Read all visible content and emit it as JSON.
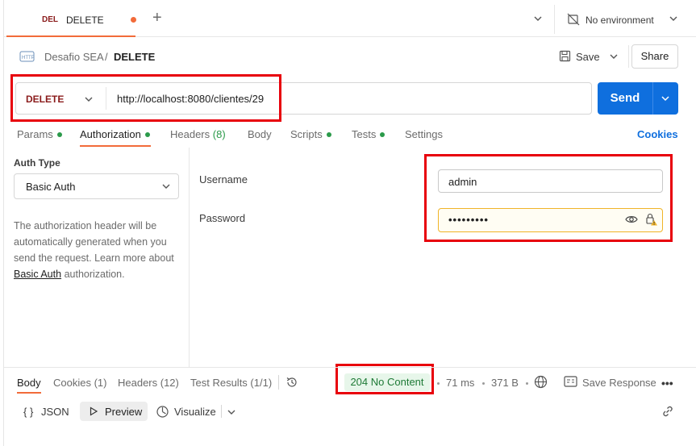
{
  "tab": {
    "method": "DEL",
    "title": "DELETE"
  },
  "environment": {
    "label": "No environment"
  },
  "breadcrumb": {
    "parent": "Desafio SEA",
    "separator": "/",
    "current": "DELETE"
  },
  "header_actions": {
    "save_label": "Save",
    "share_label": "Share"
  },
  "request": {
    "method": "DELETE",
    "url": "http://localhost:8080/clientes/29",
    "send_label": "Send"
  },
  "request_tabs": {
    "params": "Params",
    "authorization": "Authorization",
    "headers": "Headers",
    "headers_count": "(8)",
    "body": "Body",
    "scripts": "Scripts",
    "tests": "Tests",
    "settings": "Settings",
    "cookies": "Cookies"
  },
  "auth": {
    "type_label": "Auth Type",
    "type_value": "Basic Auth",
    "description_prefix": "The authorization header will be automatically generated when you send the request. Learn more about",
    "description_link": "Basic Auth",
    "description_suffix": "authorization.",
    "username_label": "Username",
    "username_value": "admin",
    "password_label": "Password",
    "password_value": "•••••••••"
  },
  "response": {
    "tabs": {
      "body": "Body",
      "cookies": "Cookies (1)",
      "headers": "Headers (12)",
      "test_results": "Test Results (1/1)"
    },
    "status": "204 No Content",
    "time": "71 ms",
    "size": "371 B",
    "save_label": "Save Response",
    "format": {
      "json": "JSON",
      "preview": "Preview",
      "visualize": "Visualize"
    }
  },
  "colors": {
    "accent": "#f26b3a",
    "send": "#0f6fde",
    "delete_method": "#8a1b1b",
    "highlight": "#e8000b",
    "status_ok": "#1e7a36"
  },
  "icons": {
    "tab_add": "plus-icon",
    "environment": "no-environment-icon",
    "request_type": "http-icon",
    "save": "save-icon",
    "password_visibility": "eye-icon",
    "password_warning": "lock-warning-icon",
    "history": "history-icon",
    "network": "globe-icon",
    "more": "more-icon",
    "link": "link-icon"
  }
}
